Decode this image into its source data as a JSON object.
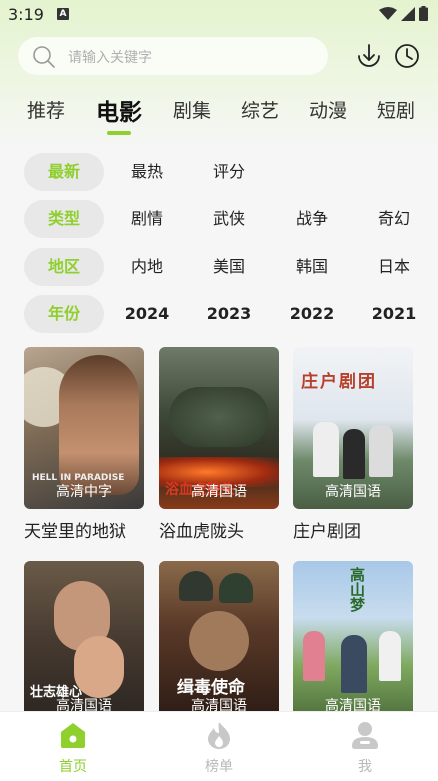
{
  "status": {
    "time": "3:19",
    "notif": "A"
  },
  "search": {
    "placeholder": "请输入关键字"
  },
  "tabs": [
    "推荐",
    "电影",
    "剧集",
    "综艺",
    "动漫",
    "短剧"
  ],
  "filters": [
    {
      "label": "最新",
      "options": [
        "最热",
        "评分"
      ]
    },
    {
      "label": "类型",
      "options": [
        "剧情",
        "武侠",
        "战争",
        "奇幻"
      ]
    },
    {
      "label": "地区",
      "options": [
        "内地",
        "美国",
        "韩国",
        "日本"
      ]
    },
    {
      "label": "年份",
      "options": [
        "2024",
        "2023",
        "2022",
        "2021"
      ]
    }
  ],
  "movies": [
    {
      "title": "天堂里的地狱",
      "badge": "高清中字",
      "poster_text": "HELL IN PARADISE"
    },
    {
      "title": "浴血虎陇头",
      "badge": "高清国语",
      "poster_text": "浴血虎陇头"
    },
    {
      "title": "庄户剧团",
      "badge": "高清国语",
      "poster_text": "庄户剧团"
    },
    {
      "title": "",
      "badge": "高清国语",
      "poster_text": "壮志雄心"
    },
    {
      "title": "",
      "badge": "高清国语",
      "poster_text": "缉毒使命"
    },
    {
      "title": "",
      "badge": "高清国语",
      "poster_text": "高山梦"
    }
  ],
  "nav": [
    {
      "label": "首页",
      "icon": "home-icon"
    },
    {
      "label": "榜单",
      "icon": "fire-icon"
    },
    {
      "label": "我",
      "icon": "user-icon"
    }
  ],
  "colors": {
    "accent": "#8fcf2e",
    "chip_bg": "#e8e8e8",
    "inactive": "#b8b8b8"
  }
}
